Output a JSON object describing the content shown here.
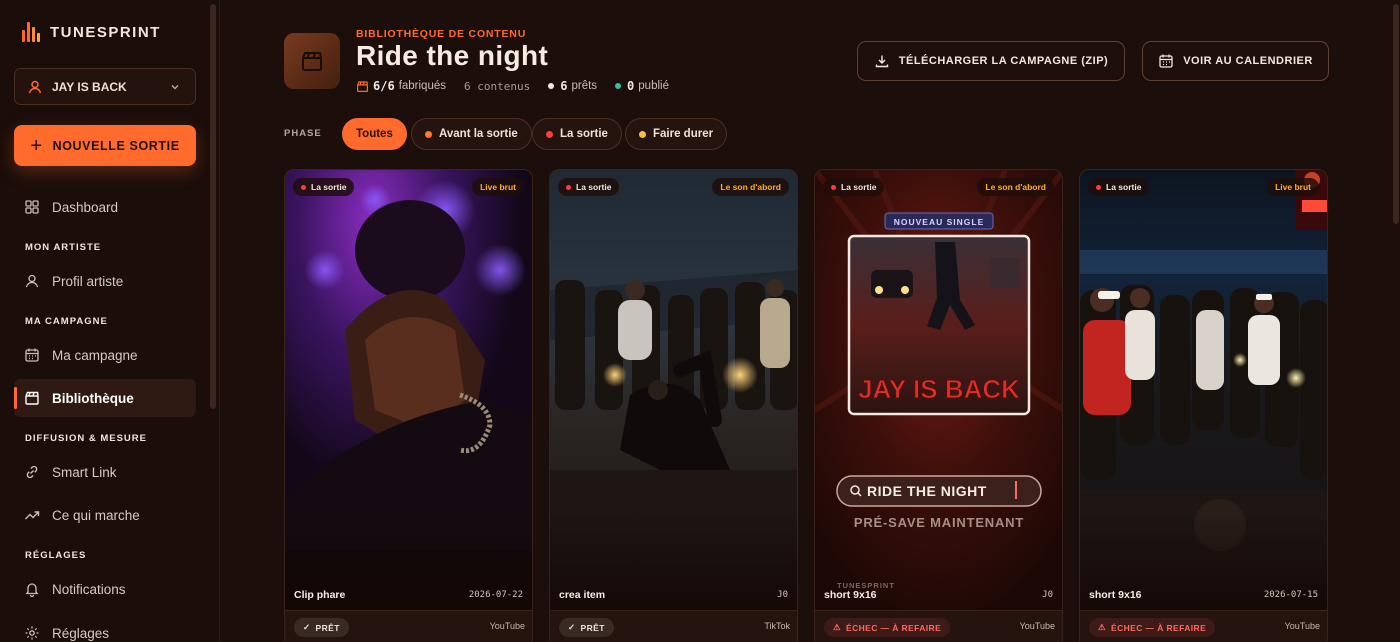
{
  "app": {
    "name": "TUNESPRINT"
  },
  "sidebar": {
    "artist_select": {
      "value": "JAY IS BACK"
    },
    "new_release_label": "NOUVELLE SORTIE",
    "items": {
      "dashboard": "Dashboard",
      "section_artist": "MON ARTISTE",
      "profile": "Profil artiste",
      "section_campaign": "MA CAMPAGNE",
      "campaign": "Ma campagne",
      "library": "Bibliothèque",
      "section_broadcast": "DIFFUSION & MESURE",
      "smartlink": "Smart Link",
      "whatworks": "Ce qui marche",
      "section_settings": "RÉGLAGES",
      "notifications": "Notifications",
      "settings": "Réglages"
    }
  },
  "header": {
    "eyebrow": "BIBLIOTHÈQUE DE CONTENU",
    "title": "Ride the night",
    "stats": {
      "fabricated_count": "6/6",
      "fabricated_label": "fabriqués",
      "contents": "6 contenus",
      "ready_count": "6",
      "ready_label": "prêts",
      "published_count": "0",
      "published_label": "publié"
    },
    "download_label": "TÉLÉCHARGER LA CAMPAGNE (ZIP)",
    "calendar_label": "VOIR AU CALENDRIER"
  },
  "filters": {
    "label": "PHASE",
    "chips": [
      "Toutes",
      "Avant la sortie",
      "La sortie",
      "Faire durer"
    ],
    "active": "Toutes"
  },
  "cards": [
    {
      "phase": "La sortie",
      "tag": "Live brut",
      "name": "Clip phare",
      "meta": "2026-07-22",
      "status": "PRÊT",
      "platform": "YouTube"
    },
    {
      "phase": "La sortie",
      "tag": "Le son d'abord",
      "name": "crea item",
      "meta": "J0",
      "status": "PRÊT",
      "platform": "TikTok"
    },
    {
      "phase": "La sortie",
      "tag": "Le son d'abord",
      "name": "short 9x16",
      "meta": "J0",
      "status": "ÉCHEC — À REFAIRE",
      "platform": "YouTube",
      "poster": {
        "kicker": "NOUVEAU SINGLE",
        "artist": "JAY IS BACK",
        "search": "RIDE THE NIGHT",
        "cta": "PRÉ-SAVE MAINTENANT",
        "watermark": "TUNESPRINT"
      }
    },
    {
      "phase": "La sortie",
      "tag": "Live brut",
      "name": "short 9x16",
      "meta": "2026-07-15",
      "status": "ÉCHEC — À REFAIRE",
      "platform": "YouTube"
    }
  ],
  "colors": {
    "accent": "#ff6b2c",
    "background": "#1c0e0b",
    "fail": "#ff6a60",
    "pre_release": "#ff7a2f",
    "release": "#ff3b3b",
    "sustain": "#f2c23a"
  }
}
